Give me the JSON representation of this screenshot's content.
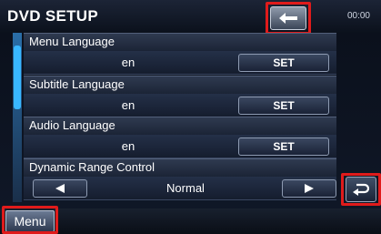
{
  "header": {
    "title": "DVD SETUP",
    "clock": "00:00"
  },
  "rows": [
    {
      "label": "Menu Language",
      "value": "en",
      "button": "SET"
    },
    {
      "label": "Subtitle Language",
      "value": "en",
      "button": "SET"
    },
    {
      "label": "Audio Language",
      "value": "en",
      "button": "SET"
    },
    {
      "label": "Dynamic Range Control",
      "value": "Normal"
    }
  ],
  "footer": {
    "menu_label": "Menu"
  },
  "colors": {
    "highlight": "#e01b1b",
    "scroll_accent": "#39b7ff"
  },
  "icons": {
    "back": "left-arrow-icon",
    "return": "return-icon",
    "prev": "left-triangle-icon",
    "next": "right-triangle-icon"
  }
}
